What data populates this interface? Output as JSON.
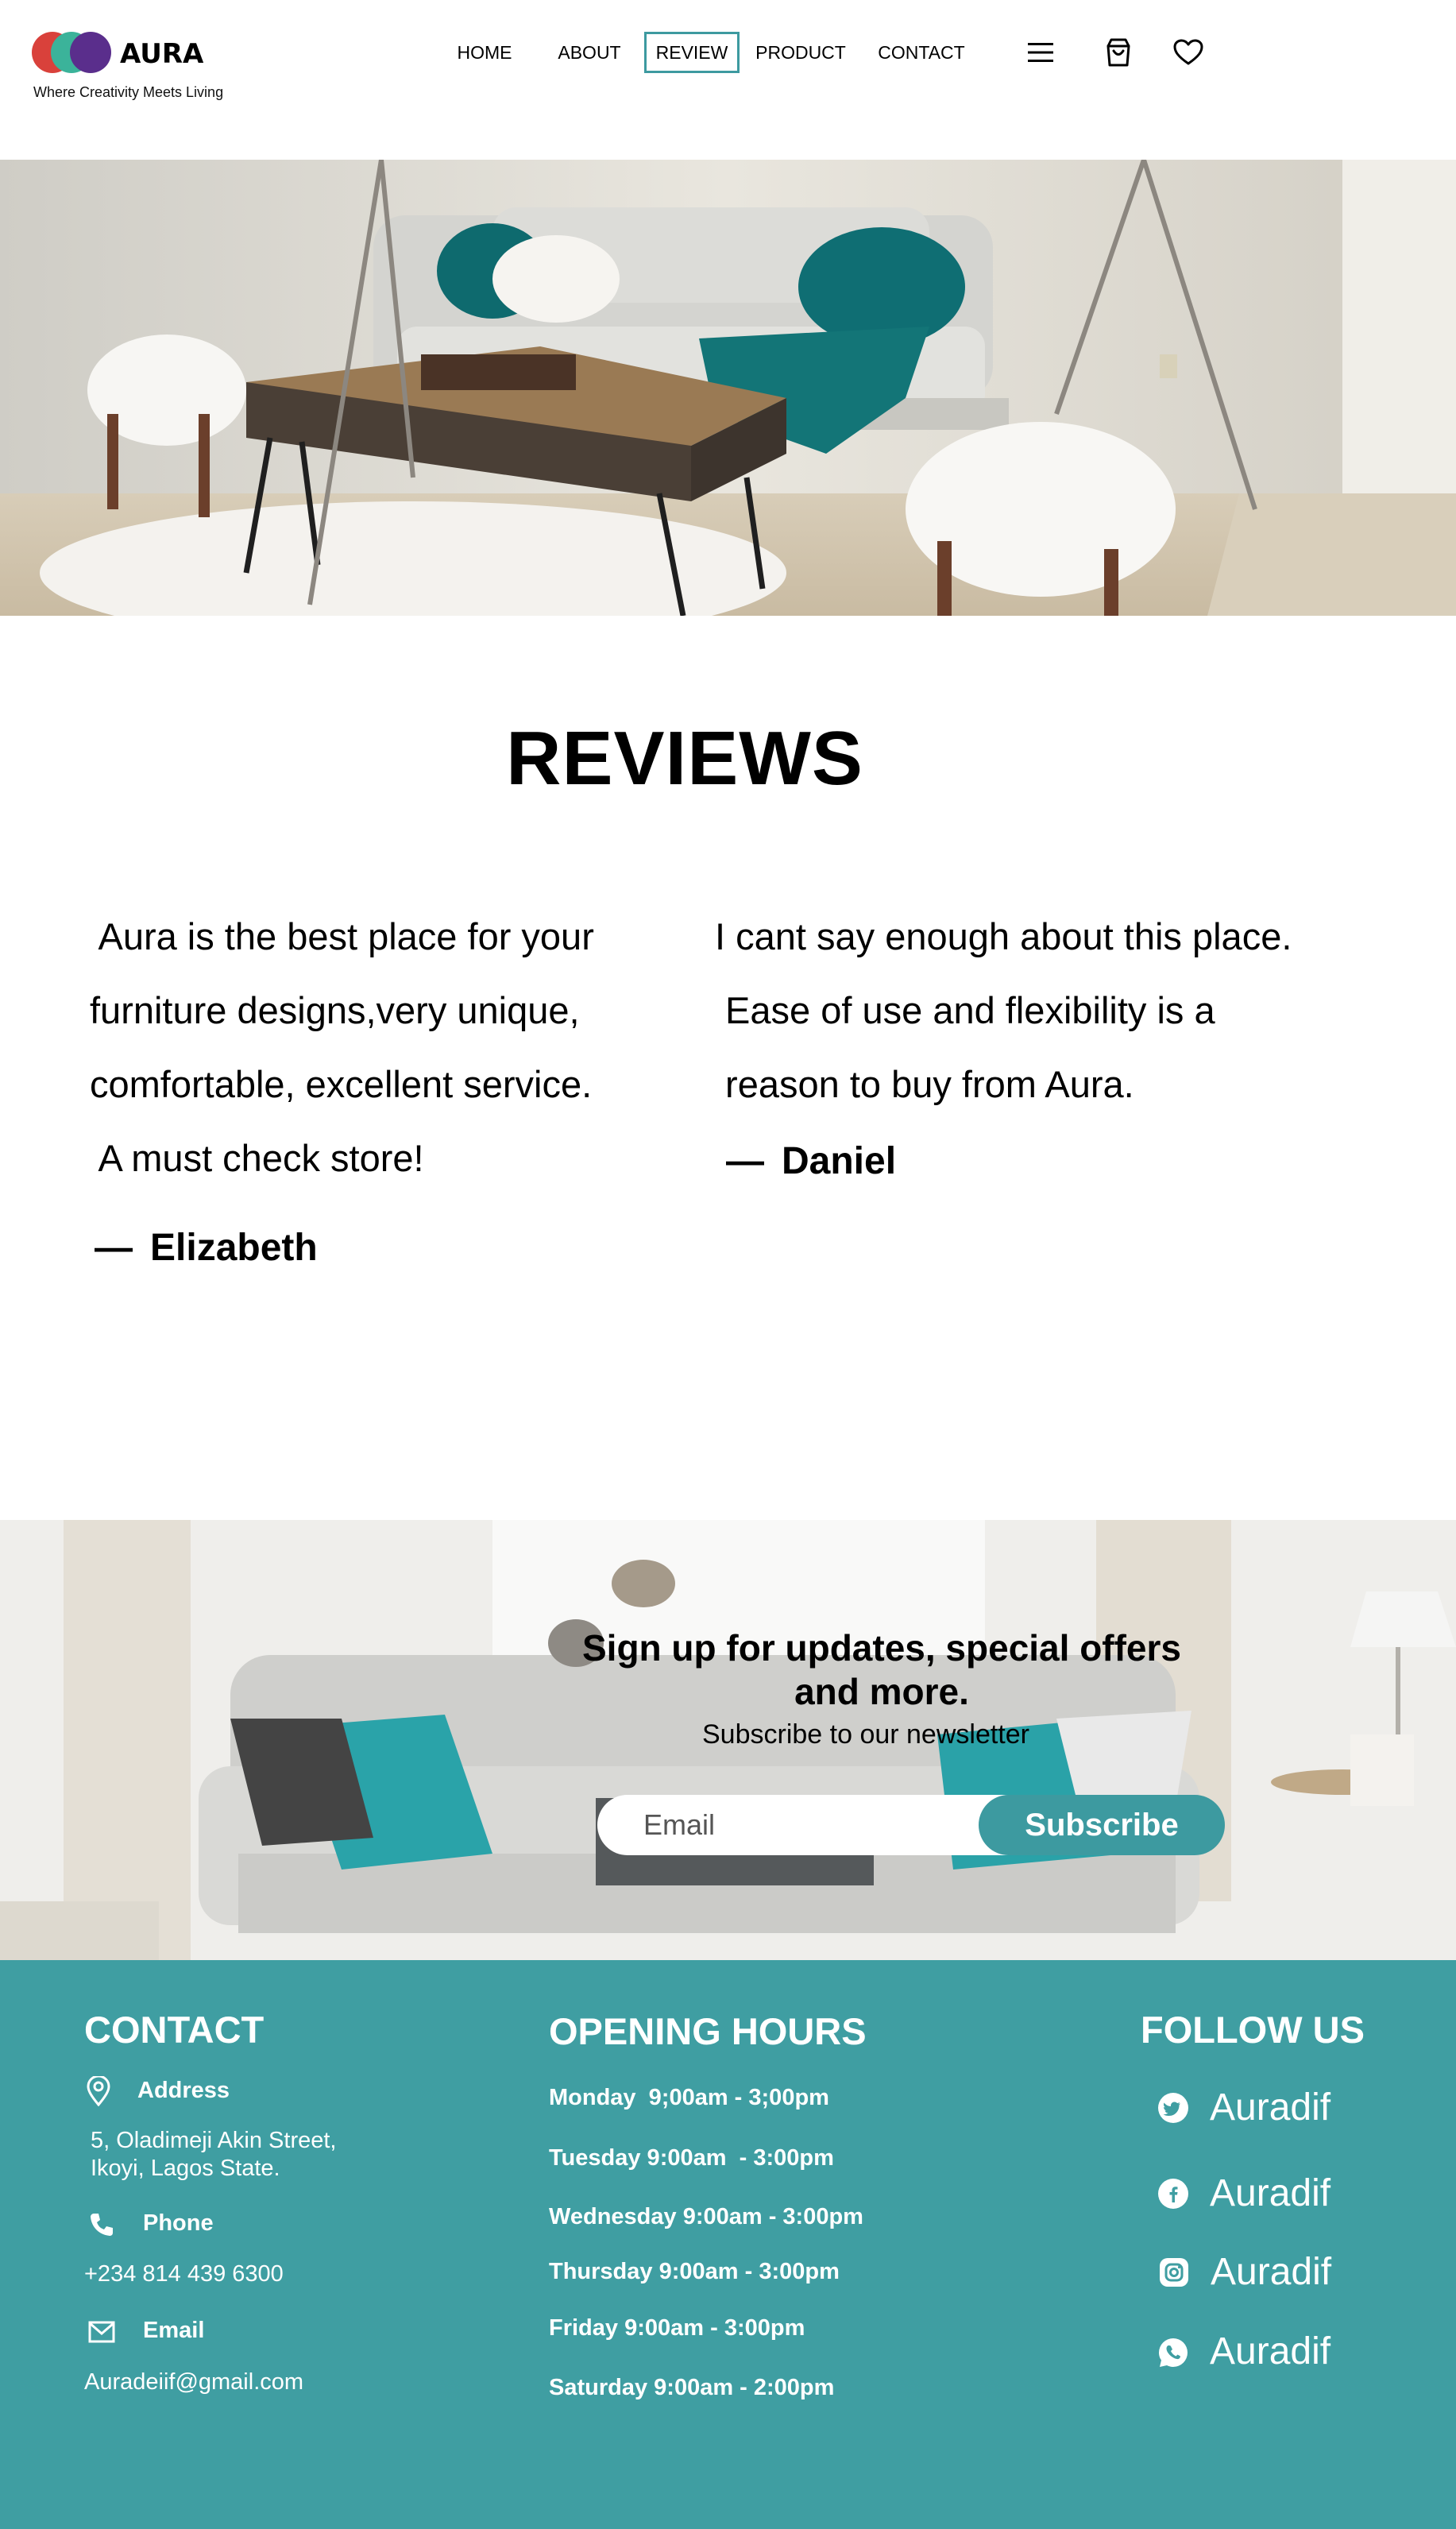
{
  "brand": {
    "name": "AURA",
    "tagline": "Where Creativity Meets Living",
    "colors": {
      "red": "#d9413b",
      "teal": "#3bb39a",
      "purple": "#5a2e8c"
    }
  },
  "nav": {
    "items": [
      {
        "label": "HOME",
        "active": false
      },
      {
        "label": "ABOUT",
        "active": false
      },
      {
        "label": "REVIEW",
        "active": true
      },
      {
        "label": "PRODUCT",
        "active": false
      },
      {
        "label": "CONTACT",
        "active": false
      }
    ],
    "icons": [
      "menu-icon",
      "shopping-bag-icon",
      "heart-icon"
    ]
  },
  "reviews": {
    "title": "REVIEWS",
    "items": [
      {
        "lines": [
          " Aura is the best place for your",
          "furniture designs,very unique,",
          "comfortable, excellent service.",
          " A must check store!"
        ],
        "author": "Elizabeth"
      },
      {
        "lines": [
          "I cant say enough about this place.",
          " Ease of use and flexibility is a",
          " reason to buy from Aura."
        ],
        "author": "Daniel"
      }
    ]
  },
  "newsletter": {
    "title": "Sign up for updates, special offers and more.",
    "subtitle": "Subscribe to our newsletter",
    "email_placeholder": "Email",
    "button_label": "Subscribe"
  },
  "footer": {
    "accent": "#3f9ea2",
    "contact": {
      "heading": "CONTACT",
      "address_label": "Address",
      "address_line1": "5, Oladimeji Akin Street,",
      "address_line2": "Ikoyi, Lagos State.",
      "phone_label": "Phone",
      "phone": "+234 814 439 6300",
      "email_label": "Email",
      "email": "Auradeiif@gmail.com"
    },
    "hours": {
      "heading": "OPENING HOURS",
      "lines": [
        "Monday  9;00am - 3;00pm",
        "Tuesday 9:00am  - 3:00pm",
        "Wednesday 9:00am - 3:00pm",
        "Thursday 9:00am - 3:00pm",
        "Friday 9:00am - 3:00pm",
        "Saturday 9:00am - 2:00pm"
      ]
    },
    "follow": {
      "heading": "FOLLOW US",
      "items": [
        {
          "icon": "twitter-icon",
          "handle": "Auradif"
        },
        {
          "icon": "facebook-icon",
          "handle": "Auradif"
        },
        {
          "icon": "instagram-icon",
          "handle": "Auradif"
        },
        {
          "icon": "whatsapp-icon",
          "handle": "Auradif"
        }
      ]
    }
  }
}
